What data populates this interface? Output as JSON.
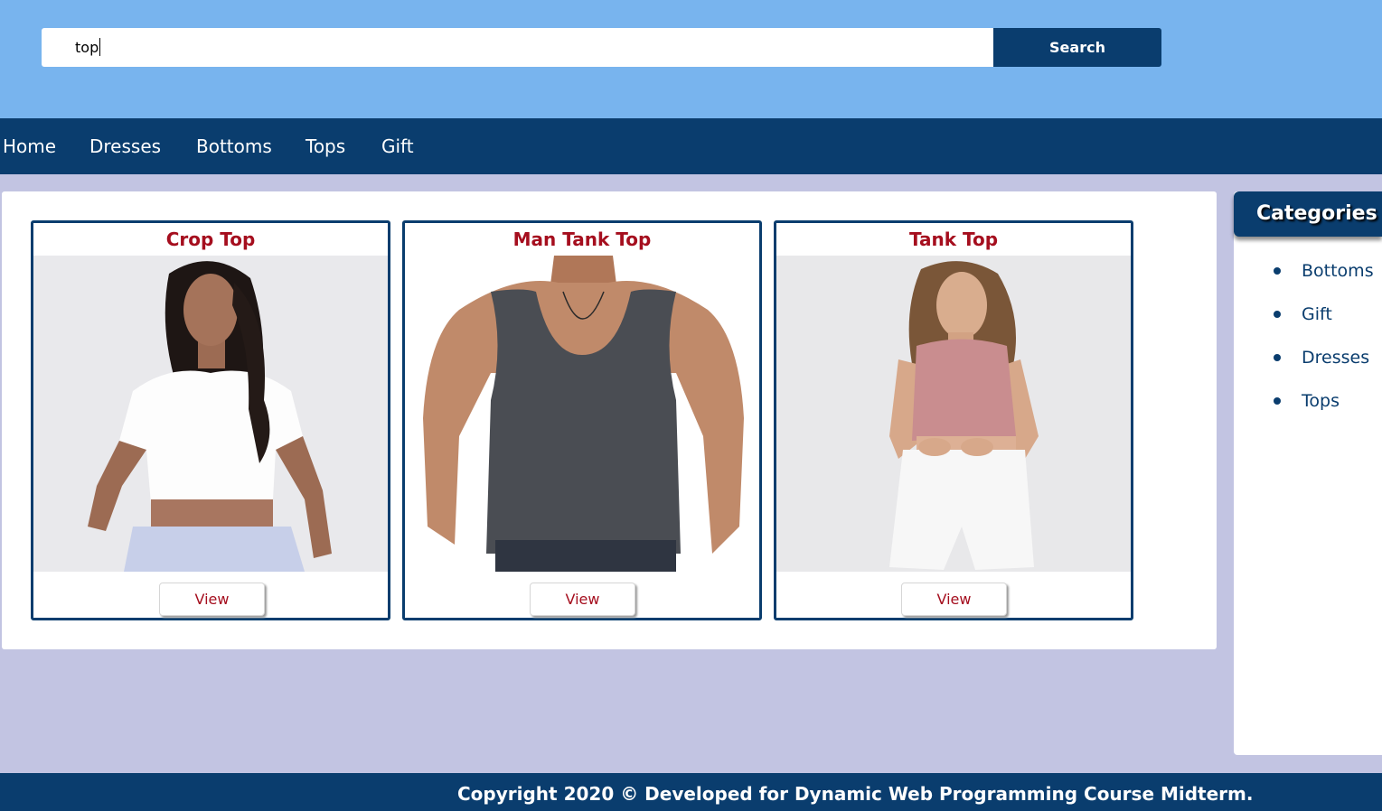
{
  "search": {
    "value": "top",
    "button_label": "Search"
  },
  "nav": {
    "items": [
      "Home",
      "Dresses",
      "Bottoms",
      "Tops",
      "Gift"
    ]
  },
  "products": [
    {
      "title": "Crop Top",
      "view_label": "View"
    },
    {
      "title": "Man Tank Top",
      "view_label": "View"
    },
    {
      "title": "Tank Top",
      "view_label": "View"
    }
  ],
  "sidebar": {
    "title": "Categories",
    "items": [
      "Bottoms",
      "Gift",
      "Dresses",
      "Tops"
    ]
  },
  "footer": {
    "text": "Copyright 2020 © Developed for Dynamic Web Programming Course Midterm."
  },
  "colors": {
    "header_bg": "#78b4ee",
    "primary_navy": "#0a3d6e",
    "title_red": "#a50e1e",
    "page_bg": "#c2c4e2"
  }
}
